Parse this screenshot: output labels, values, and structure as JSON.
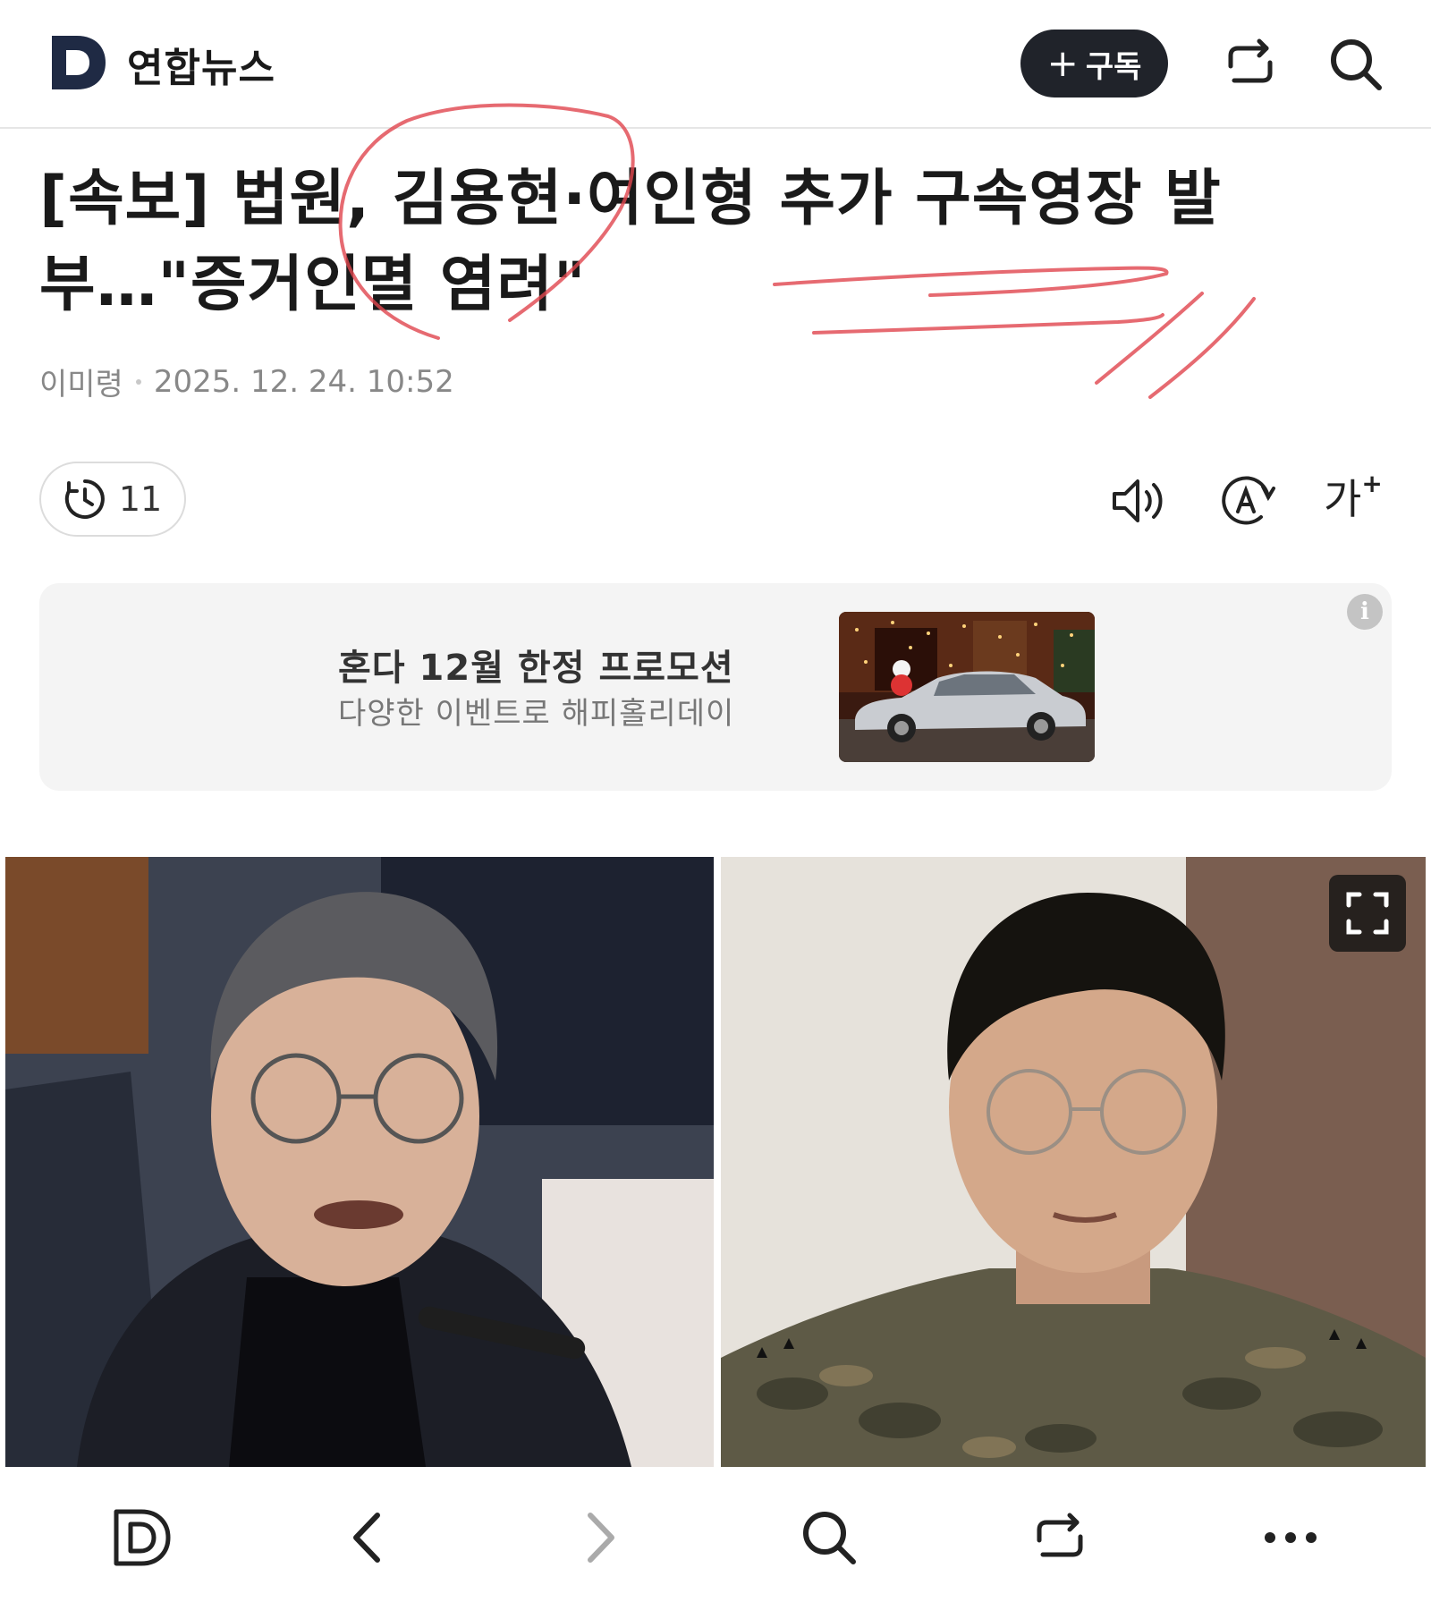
{
  "header": {
    "press_name": "연합뉴스",
    "subscribe_label": "구독",
    "subscribe_plus": "+",
    "icons": [
      "press-logo-icon",
      "share-icon",
      "search-icon"
    ]
  },
  "article": {
    "headline": "[속보] 법원, 김용현·여인형 추가 구속영장 발부…\"증거인멸 염려\"",
    "author": "이미령",
    "timestamp": "2025. 12. 24. 10:52"
  },
  "toolbar": {
    "reading_time": "11",
    "font_size_label": "가",
    "font_size_plus": "+",
    "icons": [
      "clock-icon",
      "speaker-icon",
      "translate-icon",
      "font-size-icon"
    ]
  },
  "ad": {
    "title": "혼다 12월 한정 프로모션",
    "subtitle": "다양한 이벤트로 해피홀리데이",
    "info_label": "i"
  },
  "bottom_nav": {
    "icons": [
      "home-d-icon",
      "back-icon",
      "forward-icon",
      "search-icon",
      "share-icon",
      "more-icon"
    ]
  },
  "colors": {
    "brand_dark": "#20232a",
    "scribble_red": "#e0464e",
    "ad_background": "#f4f4f4"
  }
}
